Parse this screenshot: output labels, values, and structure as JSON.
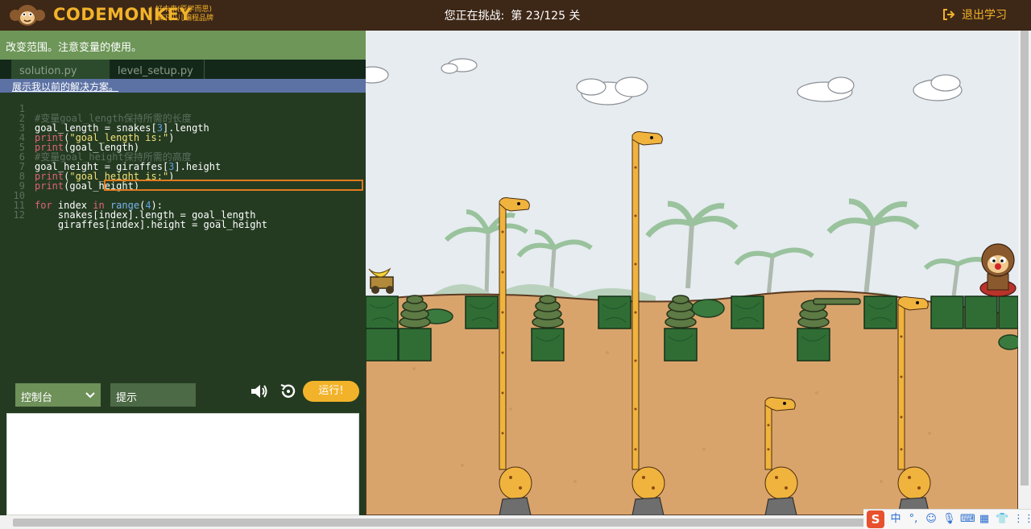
{
  "header": {
    "logo_text": "CODEMONKEY",
    "tagline_line1": "好未来(原学而思)",
    "tagline_line2": "旗下少儿编程品牌",
    "challenge_label": "您正在挑战:",
    "challenge_value": "第 23/125 关",
    "exit_label": "退出学习"
  },
  "instructions": "改变范围。注意变量的使用。",
  "tabs": [
    {
      "label": "solution.py",
      "active": true
    },
    {
      "label": "level_setup.py",
      "active": false
    }
  ],
  "show_previous_label": "展示我以前的解决方案。",
  "code_lines": [
    {
      "n": "1",
      "text": "#变量goal_length保持所需的长度"
    },
    {
      "n": "2",
      "text": "goal_length = snakes[3].length"
    },
    {
      "n": "3",
      "text": "print(\"goal_length is:\")"
    },
    {
      "n": "4",
      "text": "print(goal_length)"
    },
    {
      "n": "5",
      "text": "#变量goal_height保持所需的高度"
    },
    {
      "n": "6",
      "text": "goal_height = giraffes[3].height"
    },
    {
      "n": "7",
      "text": "print(\"goal_height is:\")"
    },
    {
      "n": "8",
      "text": "print(goal_height)"
    },
    {
      "n": "9",
      "text": ""
    },
    {
      "n": "10",
      "text": "for index in range(4):"
    },
    {
      "n": "11",
      "text": "    snakes[index].length = goal_length"
    },
    {
      "n": "12",
      "text": "    giraffes[index].height = goal_height"
    }
  ],
  "controls": {
    "console_tab": "控制台",
    "hint_tab": "提示",
    "run_label": "运行!",
    "speaker_icon": "speaker-icon",
    "reset_icon": "reset-icon"
  },
  "console_output": "",
  "tray": {
    "ime_label": "中",
    "punct_label": "°,",
    "logo_letter": "S"
  },
  "colors": {
    "topbar": "#3d2717",
    "accent": "#f2b32a",
    "editor_bg": "#243b22",
    "instructions_bg": "#6d9658"
  }
}
